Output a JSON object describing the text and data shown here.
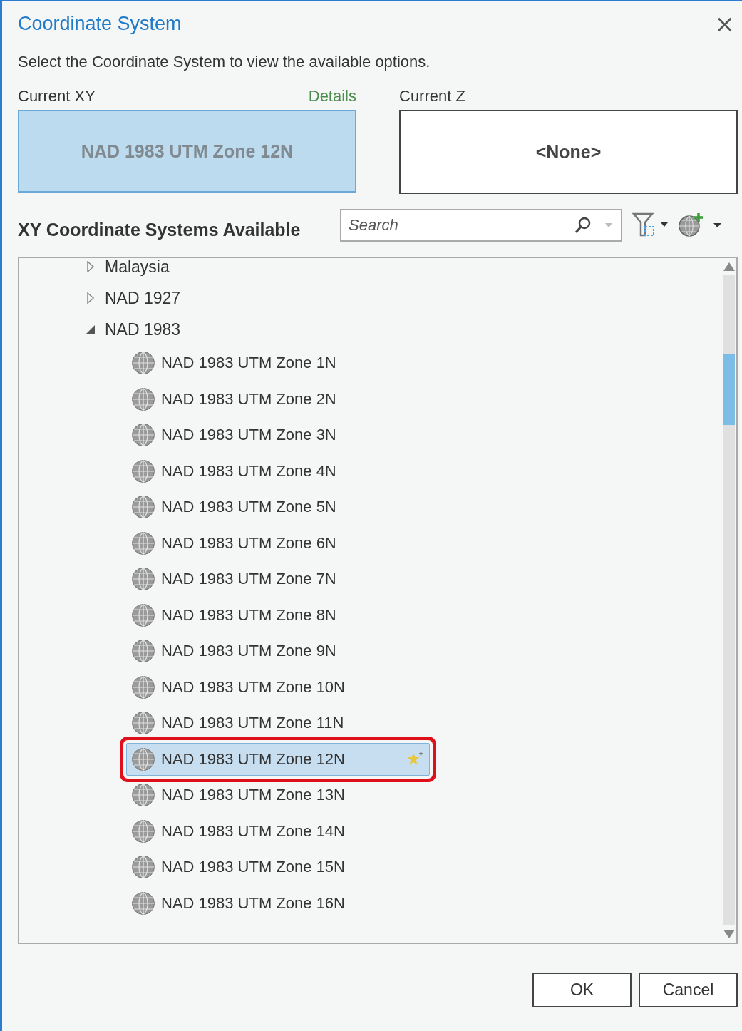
{
  "window": {
    "title": "Coordinate System",
    "close": "×"
  },
  "instruction": "Select the Coordinate System to view the available options.",
  "current_xy": {
    "label": "Current XY",
    "link": "Details",
    "value": "NAD 1983 UTM Zone 12N"
  },
  "current_z": {
    "label": "Current Z",
    "value": "<None>"
  },
  "available": {
    "heading": "XY Coordinate Systems Available",
    "search": {
      "placeholder": "Search"
    }
  },
  "tree": [
    {
      "label": "Malaysia",
      "expanded": false
    },
    {
      "label": "NAD 1927",
      "expanded": false
    },
    {
      "label": "NAD 1983",
      "expanded": true,
      "children": [
        {
          "label": "NAD 1983 UTM Zone 1N",
          "selected": false,
          "annotated": false
        },
        {
          "label": "NAD 1983 UTM Zone 2N",
          "selected": false,
          "annotated": false
        },
        {
          "label": "NAD 1983 UTM Zone 3N",
          "selected": false,
          "annotated": false
        },
        {
          "label": "NAD 1983 UTM Zone 4N",
          "selected": false,
          "annotated": false
        },
        {
          "label": "NAD 1983 UTM Zone 5N",
          "selected": false,
          "annotated": false
        },
        {
          "label": "NAD 1983 UTM Zone 6N",
          "selected": false,
          "annotated": false
        },
        {
          "label": "NAD 1983 UTM Zone 7N",
          "selected": false,
          "annotated": false
        },
        {
          "label": "NAD 1983 UTM Zone 8N",
          "selected": false,
          "annotated": false
        },
        {
          "label": "NAD 1983 UTM Zone 9N",
          "selected": false,
          "annotated": false
        },
        {
          "label": "NAD 1983 UTM Zone 10N",
          "selected": false,
          "annotated": false
        },
        {
          "label": "NAD 1983 UTM Zone 11N",
          "selected": false,
          "annotated": false
        },
        {
          "label": "NAD 1983 UTM Zone 12N",
          "selected": true,
          "annotated": true
        },
        {
          "label": "NAD 1983 UTM Zone 13N",
          "selected": false,
          "annotated": false
        },
        {
          "label": "NAD 1983 UTM Zone 14N",
          "selected": false,
          "annotated": false
        },
        {
          "label": "NAD 1983 UTM Zone 15N",
          "selected": false,
          "annotated": false
        },
        {
          "label": "NAD 1983 UTM Zone 16N",
          "selected": false,
          "annotated": false
        }
      ]
    }
  ],
  "buttons": [
    "OK",
    "Cancel"
  ]
}
